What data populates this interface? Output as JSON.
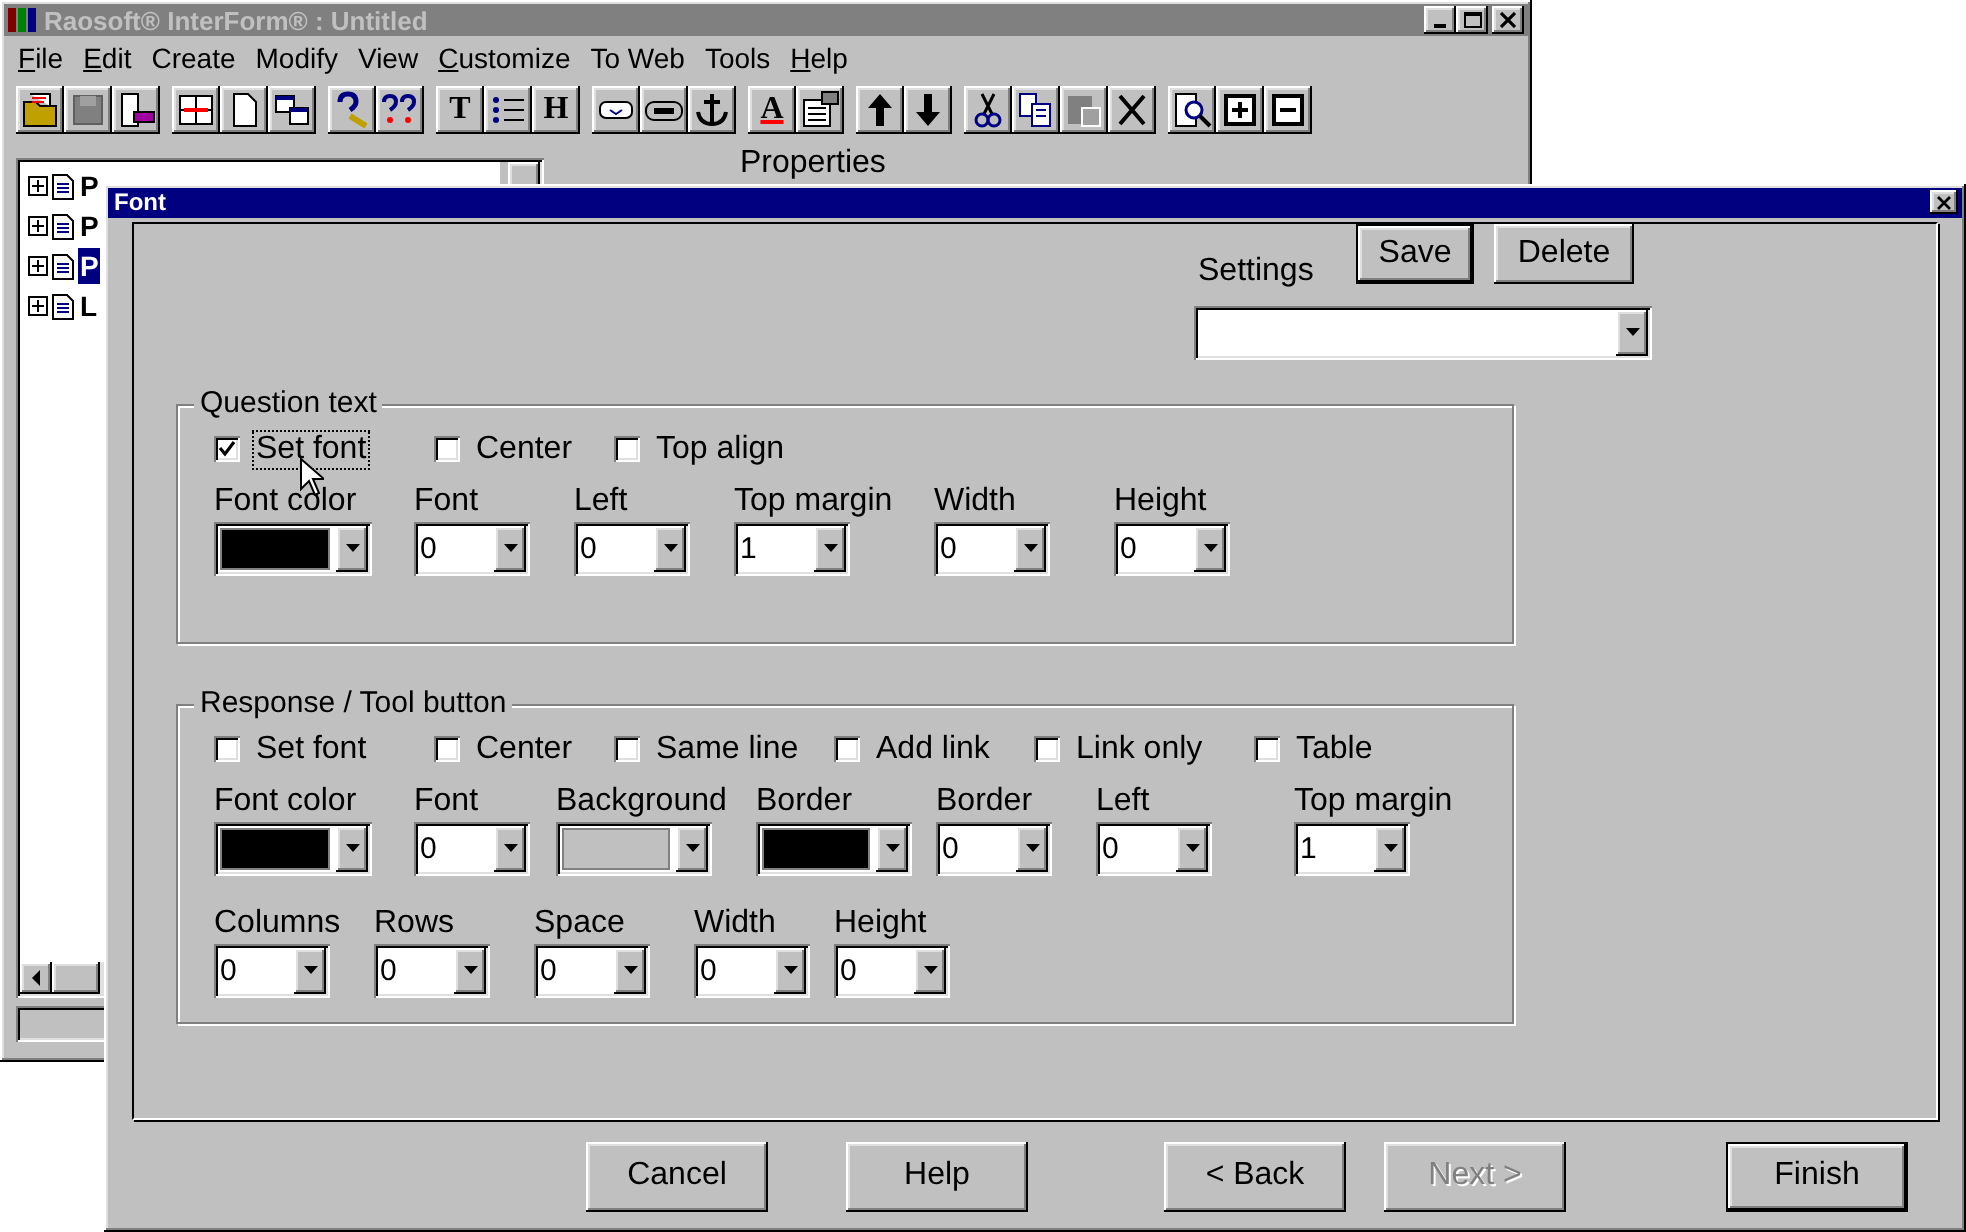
{
  "main_window": {
    "title": "Raosoft® InterForm® : Untitled",
    "menu": [
      {
        "label": "File",
        "underlined_first": true
      },
      {
        "label": "Edit",
        "underlined_first": true
      },
      {
        "label": "Create",
        "underlined_first": false
      },
      {
        "label": "Modify",
        "underlined_first": false
      },
      {
        "label": "View",
        "underlined_first": false
      },
      {
        "label": "Customize",
        "underlined_first": true
      },
      {
        "label": "To Web",
        "underlined_first": false
      },
      {
        "label": "Tools",
        "underlined_first": false
      },
      {
        "label": "Help",
        "underlined_first": true
      }
    ],
    "toolbar_letters": [
      "T",
      "H",
      "A"
    ],
    "tree": [
      {
        "label": "P",
        "selected": false
      },
      {
        "label": "P",
        "selected": false
      },
      {
        "label": "P",
        "selected": true
      },
      {
        "label": "L",
        "selected": false
      }
    ],
    "properties_label": "Properties"
  },
  "dialog": {
    "title": "Font",
    "settings_label": "Settings",
    "settings_buttons": [
      "Save",
      "Delete"
    ],
    "groups": [
      {
        "title": "Question text",
        "checkboxes": [
          {
            "label": "Set font",
            "checked": true
          },
          {
            "label": "Center",
            "checked": false
          },
          {
            "label": "Top align",
            "checked": false
          }
        ],
        "rows": [
          [
            {
              "label": "Font color",
              "kind": "color",
              "color": "#000000"
            },
            {
              "label": "Font",
              "kind": "number",
              "value": "0"
            },
            {
              "label": "Left",
              "kind": "number",
              "value": "0"
            },
            {
              "label": "Top margin",
              "kind": "number",
              "value": "1"
            },
            {
              "label": "Width",
              "kind": "number",
              "value": "0"
            },
            {
              "label": "Height",
              "kind": "number",
              "value": "0"
            }
          ]
        ]
      },
      {
        "title": "Response / Tool button",
        "checkboxes": [
          {
            "label": "Set font",
            "checked": false
          },
          {
            "label": "Center",
            "checked": false
          },
          {
            "label": "Same line",
            "checked": false
          },
          {
            "label": "Add link",
            "checked": false
          },
          {
            "label": "Link only",
            "checked": false
          },
          {
            "label": "Table",
            "checked": false
          }
        ],
        "rows": [
          [
            {
              "label": "Font color",
              "kind": "color",
              "color": "#000000"
            },
            {
              "label": "Font",
              "kind": "number",
              "value": "0"
            },
            {
              "label": "Background",
              "kind": "color",
              "color": "#c0c0c0"
            },
            {
              "label": "Border",
              "kind": "color",
              "color": "#000000"
            },
            {
              "label": "Border",
              "kind": "number",
              "value": "0"
            },
            {
              "label": "Left",
              "kind": "number",
              "value": "0"
            },
            {
              "label": "Top margin",
              "kind": "number",
              "value": "1"
            }
          ],
          [
            {
              "label": "Columns",
              "kind": "number",
              "value": "0"
            },
            {
              "label": "Rows",
              "kind": "number",
              "value": "0"
            },
            {
              "label": "Space",
              "kind": "number",
              "value": "0"
            },
            {
              "label": "Width",
              "kind": "number",
              "value": "0"
            },
            {
              "label": "Height",
              "kind": "number",
              "value": "0"
            }
          ]
        ]
      }
    ],
    "buttons": [
      {
        "label": "Cancel",
        "disabled": false,
        "default": false
      },
      {
        "label": "Help",
        "disabled": false,
        "default": false
      },
      {
        "label": "< Back",
        "disabled": false,
        "default": false
      },
      {
        "label": "Next >",
        "disabled": true,
        "default": false
      },
      {
        "label": "Finish",
        "disabled": false,
        "default": true
      }
    ]
  }
}
